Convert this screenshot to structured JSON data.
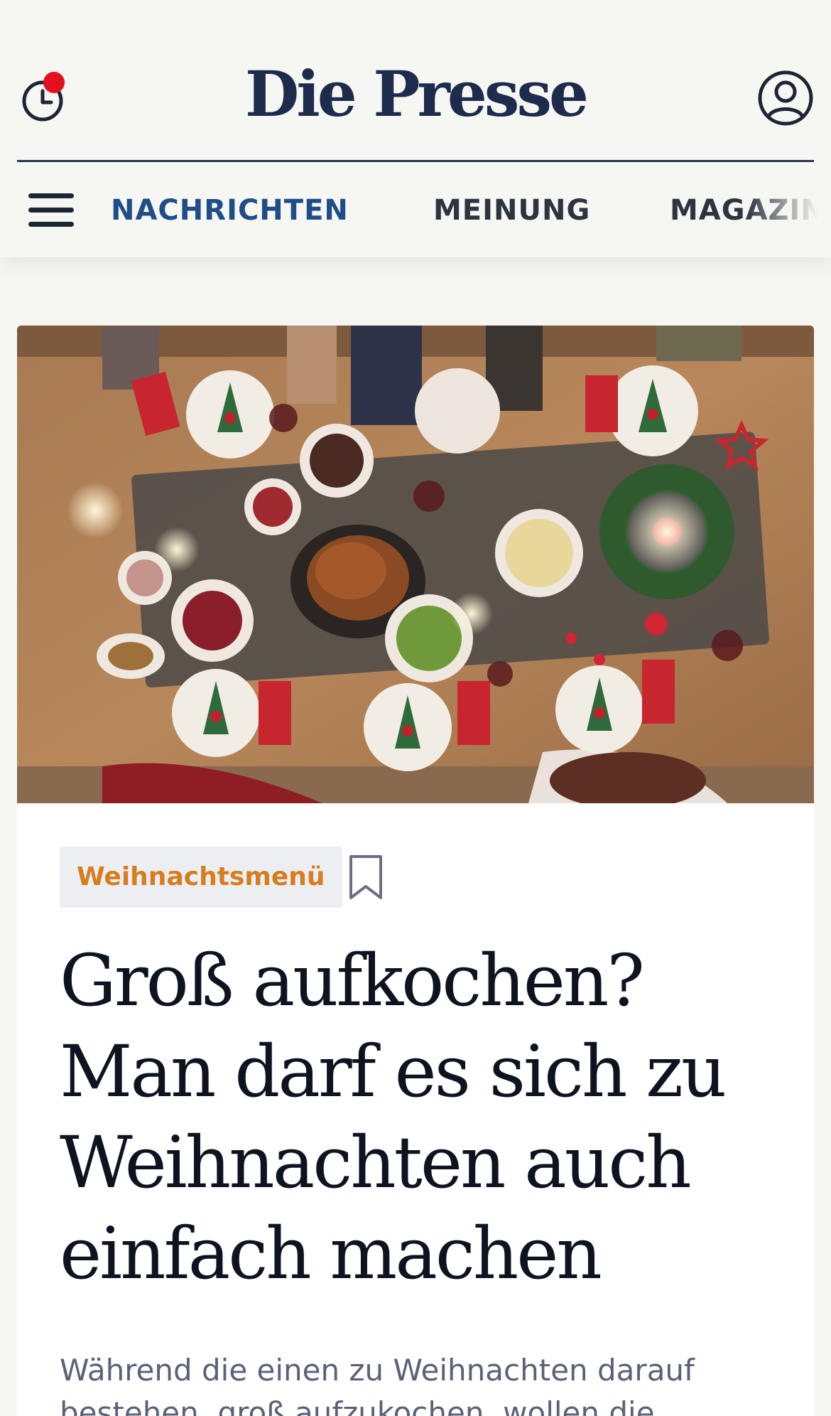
{
  "header": {
    "logo": "Die Presse",
    "history_notification": true,
    "notification_color": "#e3101e",
    "brand_color": "#1d2b4c"
  },
  "nav": {
    "items": [
      {
        "label": "NACHRICHTEN",
        "active": true
      },
      {
        "label": "MEINUNG",
        "active": false
      },
      {
        "label": "MAGAZIN",
        "active": false
      }
    ],
    "active_color": "#1f4d86"
  },
  "article": {
    "image_alt": "Festlich gedeckter Weihnachtstisch von oben",
    "tag": "Weihnachtsmenü",
    "tag_color": "#d67d1f",
    "headline": "Groß aufkochen? Man darf es sich zu Weihnachten auch einfach machen",
    "lead": "Während die einen zu Weihnachten darauf bestehen, groß aufzukochen, wollen die"
  },
  "icons": {
    "history": "clock-icon",
    "account": "user-icon",
    "menu": "hamburger-icon",
    "bookmark": "bookmark-icon"
  }
}
